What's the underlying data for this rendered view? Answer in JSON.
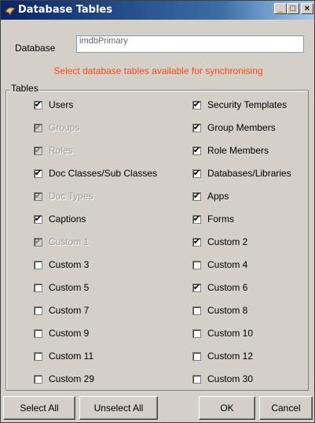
{
  "window": {
    "title": "Database Tables"
  },
  "titlebar_buttons": {
    "minimize": "_",
    "maximize": "□",
    "close": "×"
  },
  "database": {
    "label": "Database",
    "value": "imdbPrimary"
  },
  "info_text": "Select database tables available for synchronising",
  "tables_group": {
    "legend": "Tables",
    "left": [
      {
        "label": "Users",
        "checked": true,
        "disabled": false
      },
      {
        "label": "Groups",
        "checked": true,
        "disabled": true
      },
      {
        "label": "Roles",
        "checked": true,
        "disabled": true
      },
      {
        "label": "Doc Classes/Sub Classes",
        "checked": true,
        "disabled": false
      },
      {
        "label": "Doc Types",
        "checked": true,
        "disabled": true
      },
      {
        "label": "Captions",
        "checked": true,
        "disabled": false
      },
      {
        "label": "Custom 1",
        "checked": true,
        "disabled": true
      },
      {
        "label": "Custom 3",
        "checked": false,
        "disabled": false
      },
      {
        "label": "Custom 5",
        "checked": false,
        "disabled": false
      },
      {
        "label": "Custom 7",
        "checked": false,
        "disabled": false
      },
      {
        "label": "Custom 9",
        "checked": false,
        "disabled": false
      },
      {
        "label": "Custom 11",
        "checked": false,
        "disabled": false
      },
      {
        "label": "Custom 29",
        "checked": false,
        "disabled": false
      }
    ],
    "right": [
      {
        "label": "Security Templates",
        "checked": true,
        "disabled": false
      },
      {
        "label": "Group Members",
        "checked": true,
        "disabled": false
      },
      {
        "label": "Role Members",
        "checked": true,
        "disabled": false
      },
      {
        "label": "Databases/Libraries",
        "checked": true,
        "disabled": false
      },
      {
        "label": "Apps",
        "checked": true,
        "disabled": false
      },
      {
        "label": "Forms",
        "checked": true,
        "disabled": false
      },
      {
        "label": "Custom 2",
        "checked": true,
        "disabled": false
      },
      {
        "label": "Custom 4",
        "checked": false,
        "disabled": false
      },
      {
        "label": "Custom 6",
        "checked": true,
        "disabled": false
      },
      {
        "label": "Custom 8",
        "checked": false,
        "disabled": false
      },
      {
        "label": "Custom 10",
        "checked": false,
        "disabled": false
      },
      {
        "label": "Custom 12",
        "checked": false,
        "disabled": false
      },
      {
        "label": "Custom 30",
        "checked": false,
        "disabled": false
      }
    ]
  },
  "buttons": {
    "select_all": "Select All",
    "unselect_all": "Unselect All",
    "ok": "OK",
    "cancel": "Cancel"
  },
  "colors": {
    "title_start": "#0a246a",
    "title_end": "#a6caf0",
    "info_text": "#ff4a14",
    "face": "#d4d0c8"
  }
}
